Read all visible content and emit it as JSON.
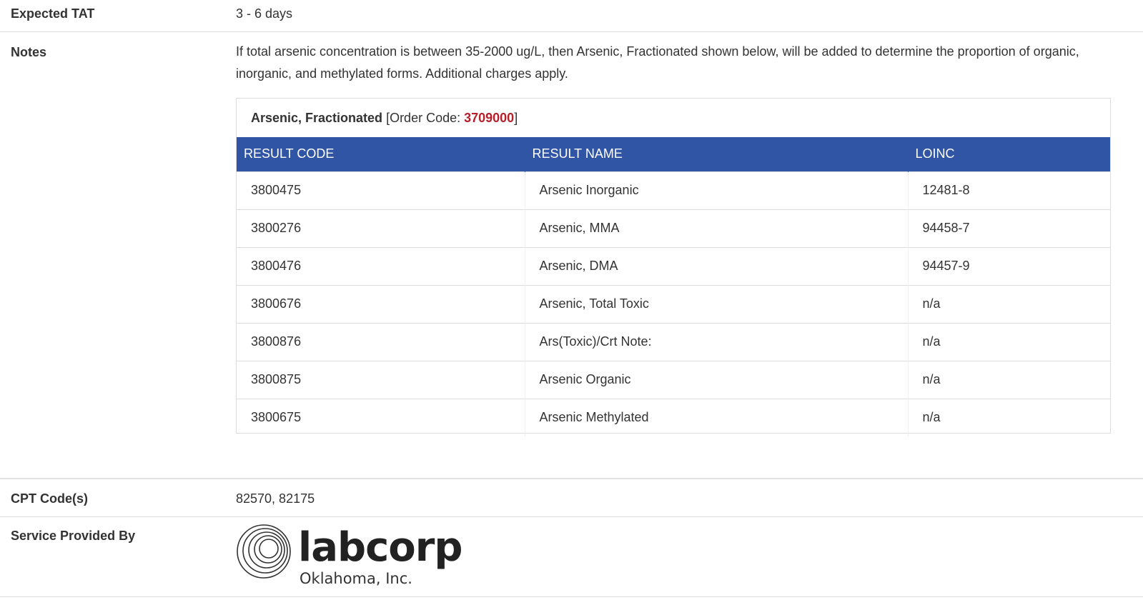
{
  "tat": {
    "label": "Expected TAT",
    "value": "3 - 6 days"
  },
  "notes": {
    "label": "Notes",
    "text": "If total arsenic concentration is between 35-2000 ug/L, then Arsenic, Fractionated shown below, will be added to determine the proportion of organic, inorganic, and methylated forms. Additional charges apply."
  },
  "panel": {
    "name": "Arsenic, Fractionated",
    "order_code_prefix": " [Order Code: ",
    "order_code": "3709000",
    "order_code_suffix": "]",
    "headers": {
      "code": "RESULT CODE",
      "name": "RESULT NAME",
      "loinc": "LOINC"
    },
    "rows": [
      {
        "code": "3800475",
        "name": "Arsenic Inorganic",
        "loinc": "12481-8"
      },
      {
        "code": "3800276",
        "name": "Arsenic, MMA",
        "loinc": "94458-7"
      },
      {
        "code": "3800476",
        "name": "Arsenic, DMA",
        "loinc": "94457-9"
      },
      {
        "code": "3800676",
        "name": "Arsenic, Total Toxic",
        "loinc": "n/a"
      },
      {
        "code": "3800876",
        "name": "Ars(Toxic)/Crt Note:",
        "loinc": "n/a"
      },
      {
        "code": "3800875",
        "name": "Arsenic Organic",
        "loinc": "n/a"
      },
      {
        "code": "3800675",
        "name": "Arsenic Methylated",
        "loinc": "n/a"
      }
    ]
  },
  "cpt": {
    "label": "CPT Code(s)",
    "value": "82570, 82175"
  },
  "service": {
    "label": "Service Provided By",
    "logo_word": "labcorp",
    "logo_sub": "Oklahoma, Inc.",
    "logo_icon": "concentric-rings-icon"
  },
  "colors": {
    "header_blue": "#3155a5",
    "order_code_red": "#b5202b",
    "text": "#333333"
  }
}
